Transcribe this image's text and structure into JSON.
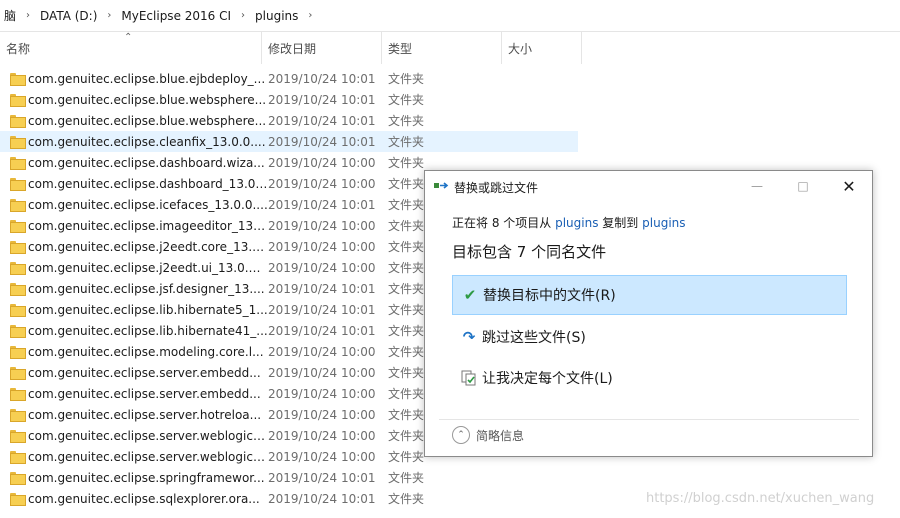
{
  "breadcrumb": [
    "脑",
    "DATA (D:)",
    "MyEclipse 2016 CI",
    "plugins"
  ],
  "columns": {
    "name": "名称",
    "date": "修改日期",
    "type": "类型",
    "size": "大小"
  },
  "files": [
    {
      "name": "com.genuitec.eclipse.blue.ejbdeploy_...",
      "date": "2019/10/24 10:01",
      "type": "文件夹"
    },
    {
      "name": "com.genuitec.eclipse.blue.websphere...",
      "date": "2019/10/24 10:01",
      "type": "文件夹"
    },
    {
      "name": "com.genuitec.eclipse.blue.websphere...",
      "date": "2019/10/24 10:01",
      "type": "文件夹"
    },
    {
      "name": "com.genuitec.eclipse.cleanfix_13.0.0....",
      "date": "2019/10/24 10:01",
      "type": "文件夹"
    },
    {
      "name": "com.genuitec.eclipse.dashboard.wiza...",
      "date": "2019/10/24 10:00",
      "type": "文件夹"
    },
    {
      "name": "com.genuitec.eclipse.dashboard_13.0....",
      "date": "2019/10/24 10:00",
      "type": "文件夹"
    },
    {
      "name": "com.genuitec.eclipse.icefaces_13.0.0....",
      "date": "2019/10/24 10:01",
      "type": "文件夹"
    },
    {
      "name": "com.genuitec.eclipse.imageeditor_13....",
      "date": "2019/10/24 10:00",
      "type": "文件夹"
    },
    {
      "name": "com.genuitec.eclipse.j2eedt.core_13.0...",
      "date": "2019/10/24 10:00",
      "type": "文件夹"
    },
    {
      "name": "com.genuitec.eclipse.j2eedt.ui_13.0.0....",
      "date": "2019/10/24 10:00",
      "type": "文件夹"
    },
    {
      "name": "com.genuitec.eclipse.jsf.designer_13....",
      "date": "2019/10/24 10:01",
      "type": "文件夹"
    },
    {
      "name": "com.genuitec.eclipse.lib.hibernate5_1...",
      "date": "2019/10/24 10:01",
      "type": "文件夹"
    },
    {
      "name": "com.genuitec.eclipse.lib.hibernate41_...",
      "date": "2019/10/24 10:01",
      "type": "文件夹"
    },
    {
      "name": "com.genuitec.eclipse.modeling.core.l...",
      "date": "2019/10/24 10:00",
      "type": "文件夹"
    },
    {
      "name": "com.genuitec.eclipse.server.embedd...",
      "date": "2019/10/24 10:00",
      "type": "文件夹"
    },
    {
      "name": "com.genuitec.eclipse.server.embedd...",
      "date": "2019/10/24 10:00",
      "type": "文件夹"
    },
    {
      "name": "com.genuitec.eclipse.server.hotreloa...",
      "date": "2019/10/24 10:00",
      "type": "文件夹"
    },
    {
      "name": "com.genuitec.eclipse.server.weblogic....",
      "date": "2019/10/24 10:00",
      "type": "文件夹"
    },
    {
      "name": "com.genuitec.eclipse.server.weblogic....",
      "date": "2019/10/24 10:00",
      "type": "文件夹"
    },
    {
      "name": "com.genuitec.eclipse.springframewor...",
      "date": "2019/10/24 10:01",
      "type": "文件夹"
    },
    {
      "name": "com.genuitec.eclipse.sqlexplorer.ora...",
      "date": "2019/10/24 10:01",
      "type": "文件夹"
    }
  ],
  "dialog": {
    "title": "替换或跳过文件",
    "progress_prefix": "正在将 8 个项目从",
    "source": "plugins",
    "progress_middle": "复制到",
    "dest": "plugins",
    "heading": "目标包含 7 个同名文件",
    "options": {
      "replace": "替换目标中的文件(R)",
      "skip": "跳过这些文件(S)",
      "decide": "让我决定每个文件(L)"
    },
    "details": "简略信息",
    "icons": {
      "title": "copy-arrow-icon",
      "replace": "checkmark-icon",
      "skip": "skip-arrow-icon",
      "decide": "compare-files-icon"
    }
  },
  "watermark": "https://blog.csdn.net/xuchen_wang",
  "colors": {
    "selected_row": "#e5f3ff",
    "option_highlight": "#cce8ff",
    "link": "#1a5fb4"
  }
}
